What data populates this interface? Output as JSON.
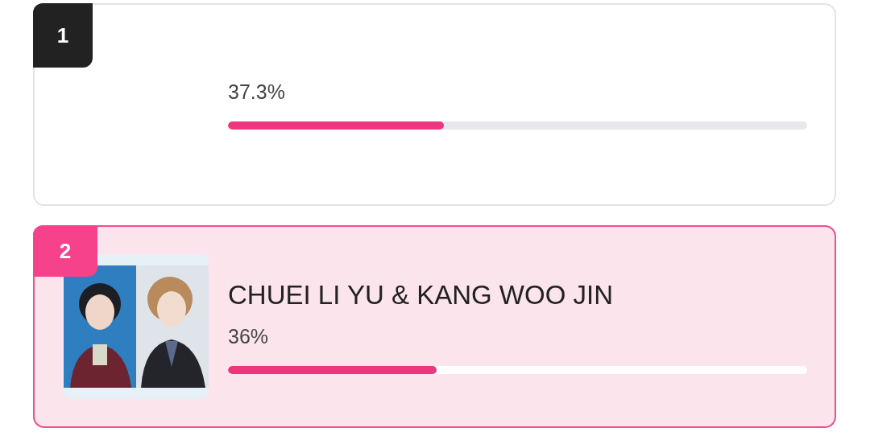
{
  "ranking": [
    {
      "rank": "1",
      "selected": false,
      "percent": "37.3%",
      "level": 0.373
    },
    {
      "rank": "2",
      "selected": true,
      "name": "CHUEI LI YU & KANG WOO JIN",
      "percent": "36%",
      "level": 0.36
    }
  ]
}
